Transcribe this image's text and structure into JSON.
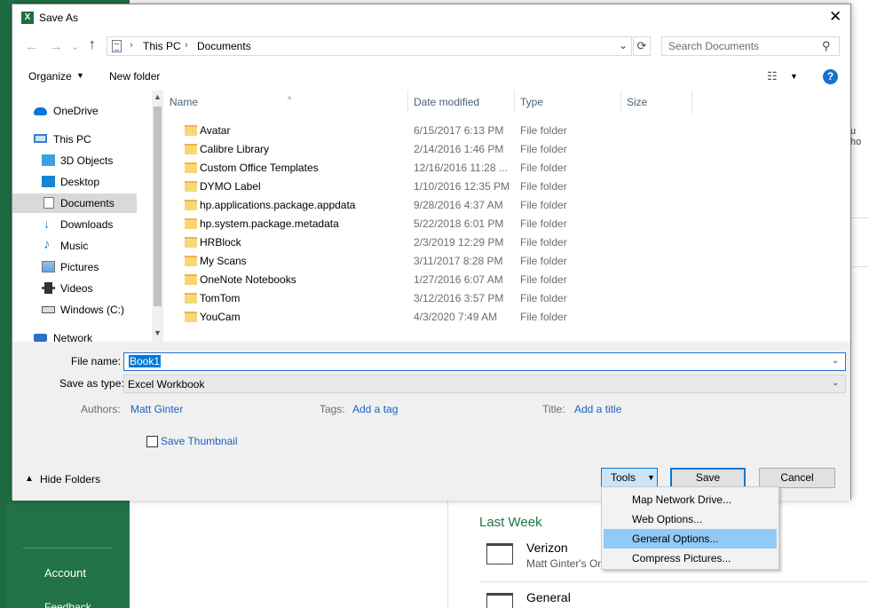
{
  "background": {
    "account_label": "Account",
    "feedback_label": "Feedback",
    "last_week_label": "Last Week",
    "recent_files": [
      {
        "name": "Verizon",
        "owner": "Matt Ginter's On"
      },
      {
        "name": "General",
        "owner": ""
      }
    ],
    "partial_text": "u ho"
  },
  "dialog": {
    "title": "Save As",
    "close_glyph": "✕",
    "nav": {
      "back": "←",
      "forward": "→",
      "recent": "⌄",
      "up": "↑"
    },
    "address": {
      "root": "This PC",
      "current": "Documents",
      "sep": "›"
    },
    "search_placeholder": "Search Documents",
    "toolbar": {
      "organize": "Organize",
      "new_folder": "New folder",
      "help": "?"
    },
    "nav_items": [
      {
        "label": "OneDrive",
        "icon": "onedrive-icon"
      },
      {
        "label": "This PC",
        "icon": "this-pc-icon"
      },
      {
        "label": "3D Objects",
        "icon": "3d-objects-icon"
      },
      {
        "label": "Desktop",
        "icon": "desktop-icon"
      },
      {
        "label": "Documents",
        "icon": "documents-icon",
        "selected": true
      },
      {
        "label": "Downloads",
        "icon": "downloads-icon"
      },
      {
        "label": "Music",
        "icon": "music-icon"
      },
      {
        "label": "Pictures",
        "icon": "pictures-icon"
      },
      {
        "label": "Videos",
        "icon": "videos-icon"
      },
      {
        "label": "Windows (C:)",
        "icon": "drive-icon"
      },
      {
        "label": "Network",
        "icon": "network-icon"
      }
    ],
    "columns": {
      "name": "Name",
      "date": "Date modified",
      "type": "Type",
      "size": "Size"
    },
    "files": [
      {
        "name": "Avatar",
        "date": "6/15/2017 6:13 PM",
        "type": "File folder"
      },
      {
        "name": "Calibre Library",
        "date": "2/14/2016 1:46 PM",
        "type": "File folder"
      },
      {
        "name": "Custom Office Templates",
        "date": "12/16/2016 11:28 ...",
        "type": "File folder"
      },
      {
        "name": "DYMO Label",
        "date": "1/10/2016 12:35 PM",
        "type": "File folder"
      },
      {
        "name": "hp.applications.package.appdata",
        "date": "9/28/2016 4:37 AM",
        "type": "File folder"
      },
      {
        "name": "hp.system.package.metadata",
        "date": "5/22/2018 6:01 PM",
        "type": "File folder"
      },
      {
        "name": "HRBlock",
        "date": "2/3/2019 12:29 PM",
        "type": "File folder"
      },
      {
        "name": "My Scans",
        "date": "3/11/2017 8:28 PM",
        "type": "File folder"
      },
      {
        "name": "OneNote Notebooks",
        "date": "1/27/2016 6:07 AM",
        "type": "File folder"
      },
      {
        "name": "TomTom",
        "date": "3/12/2016 3:57 PM",
        "type": "File folder"
      },
      {
        "name": "YouCam",
        "date": "4/3/2020 7:49 AM",
        "type": "File folder"
      }
    ],
    "form": {
      "file_name_label": "File name:",
      "file_name_value": "Book1",
      "save_type_label": "Save as type:",
      "save_type_value": "Excel Workbook",
      "authors_label": "Authors:",
      "authors_value": "Matt Ginter",
      "tags_label": "Tags:",
      "tags_value": "Add a tag",
      "title_label": "Title:",
      "title_value": "Add a title",
      "save_thumbnail": "Save Thumbnail"
    },
    "hide_folders": "Hide Folders",
    "buttons": {
      "tools": "Tools",
      "save": "Save",
      "cancel": "Cancel"
    },
    "tools_menu": [
      {
        "label": "Map Network Drive..."
      },
      {
        "label": "Web Options..."
      },
      {
        "label": "General Options...",
        "highlighted": true
      },
      {
        "label": "Compress Pictures..."
      }
    ]
  }
}
